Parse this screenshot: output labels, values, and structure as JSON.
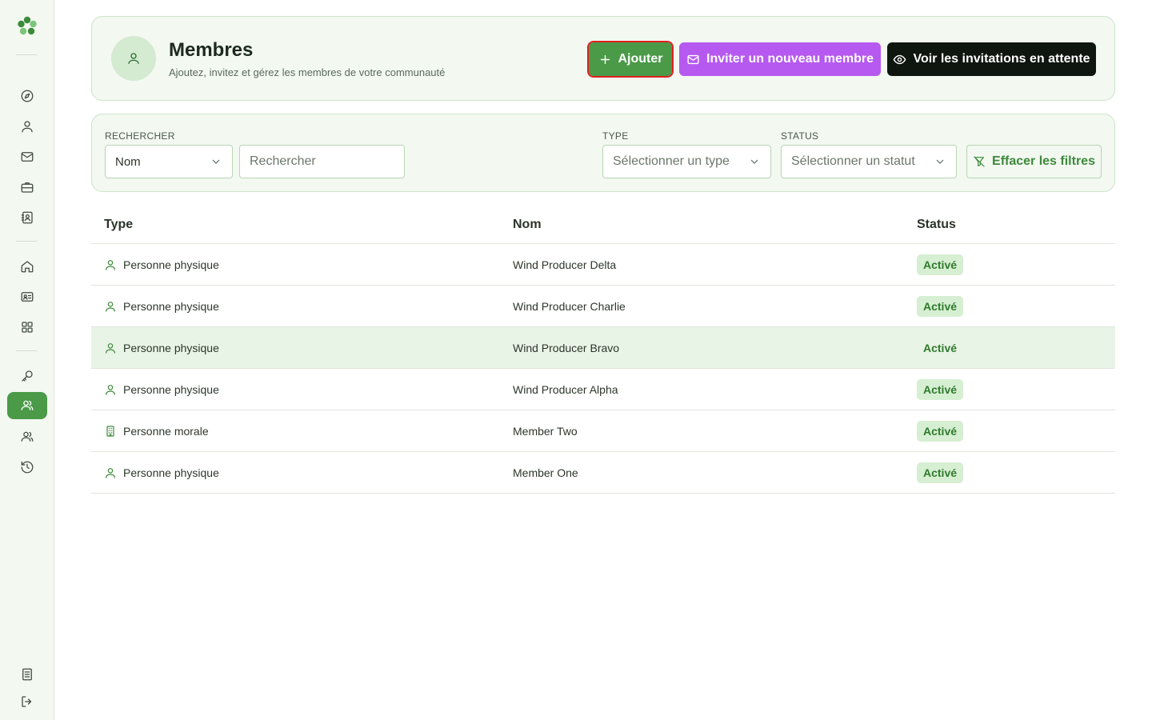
{
  "header": {
    "title": "Membres",
    "subtitle": "Ajoutez, invitez et gérez les membres de votre communauté",
    "add_label": "Ajouter",
    "invite_label": "Inviter un nouveau membre",
    "pending_label": "Voir les invitations en attente"
  },
  "filters": {
    "search_label": "RECHERCHER",
    "search_field_value": "Nom",
    "search_placeholder": "Rechercher",
    "type_label": "TYPE",
    "type_placeholder": "Sélectionner un type",
    "status_label": "STATUS",
    "status_placeholder": "Sélectionner un statut",
    "clear_label": "Effacer les filtres"
  },
  "table": {
    "columns": [
      "Type",
      "Nom",
      "Status"
    ],
    "rows": [
      {
        "type": "Personne physique",
        "icon": "user-icon",
        "name": "Wind Producer Delta",
        "status": "Activé"
      },
      {
        "type": "Personne physique",
        "icon": "user-icon",
        "name": "Wind Producer Charlie",
        "status": "Activé"
      },
      {
        "type": "Personne physique",
        "icon": "user-icon",
        "name": "Wind Producer Bravo",
        "status": "Activé"
      },
      {
        "type": "Personne physique",
        "icon": "user-icon",
        "name": "Wind Producer Alpha",
        "status": "Activé"
      },
      {
        "type": "Personne morale",
        "icon": "building-icon",
        "name": "Member Two",
        "status": "Activé"
      },
      {
        "type": "Personne physique",
        "icon": "user-icon",
        "name": "Member One",
        "status": "Activé"
      }
    ]
  },
  "colors": {
    "accent_green": "#4a9a48",
    "invite_purple": "#b659f0",
    "dark_button": "#0f150f",
    "panel_bg": "#f3f8f1",
    "badge_bg": "#d6efd2"
  }
}
